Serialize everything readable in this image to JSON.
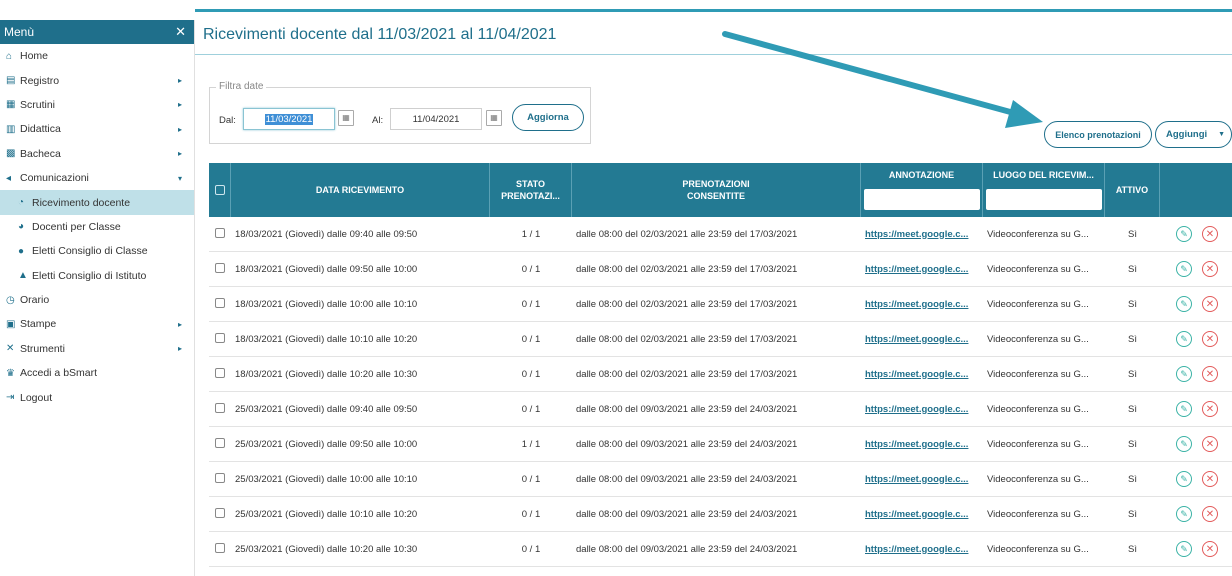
{
  "sidebar": {
    "title": "Menù",
    "close_glyph": "✕",
    "items": [
      {
        "label": "Home",
        "icon": "home-icon",
        "glyph": "⌂",
        "arrow": false,
        "sub": false,
        "active": false
      },
      {
        "label": "Registro",
        "icon": "register-icon",
        "glyph": "▤",
        "arrow": true,
        "sub": false,
        "active": false
      },
      {
        "label": "Scrutini",
        "icon": "scrutini-icon",
        "glyph": "▦",
        "arrow": true,
        "sub": false,
        "active": false
      },
      {
        "label": "Didattica",
        "icon": "book-icon",
        "glyph": "▥",
        "arrow": true,
        "sub": false,
        "active": false
      },
      {
        "label": "Bacheca",
        "icon": "board-icon",
        "glyph": "▩",
        "arrow": true,
        "sub": false,
        "active": false
      },
      {
        "label": "Comunicazioni",
        "icon": "megaphone-icon",
        "glyph": "◂",
        "arrow": true,
        "arrow_down": true,
        "sub": false,
        "active": false
      },
      {
        "label": "Ricevimento docente",
        "icon": "chat-icon",
        "glyph": "◔",
        "arrow": false,
        "sub": true,
        "active": true
      },
      {
        "label": "Docenti per Classe",
        "icon": "comment-icon",
        "glyph": "◕",
        "arrow": false,
        "sub": true,
        "active": false
      },
      {
        "label": "Eletti Consiglio di Classe",
        "icon": "group-icon",
        "glyph": "●",
        "arrow": false,
        "sub": true,
        "active": false
      },
      {
        "label": "Eletti Consiglio di Istituto",
        "icon": "building-icon",
        "glyph": "▲",
        "arrow": false,
        "sub": true,
        "active": false
      },
      {
        "label": "Orario",
        "icon": "clock-icon",
        "glyph": "◷",
        "arrow": false,
        "sub": false,
        "active": false
      },
      {
        "label": "Stampe",
        "icon": "print-icon",
        "glyph": "▣",
        "arrow": true,
        "sub": false,
        "active": false
      },
      {
        "label": "Strumenti",
        "icon": "tools-icon",
        "glyph": "✕",
        "arrow": true,
        "sub": false,
        "active": false
      },
      {
        "label": "Accedi a bSmart",
        "icon": "bsmart-icon",
        "glyph": "♛",
        "arrow": false,
        "sub": false,
        "active": false
      },
      {
        "label": "Logout",
        "icon": "logout-icon",
        "glyph": "⇥",
        "arrow": false,
        "sub": false,
        "active": false
      }
    ]
  },
  "page": {
    "title": "Ricevimenti docente dal 11/03/2021 al 11/04/2021"
  },
  "filter": {
    "legend": "Filtra date",
    "from_label": "Dal:",
    "from_value": "11/03/2021",
    "to_label": "Al:",
    "to_value": "11/04/2021",
    "refresh_label": "Aggiorna"
  },
  "toolbar": {
    "bookings_label": "Elenco prenotazioni",
    "add_label": "Aggiungi",
    "add_caret": "▼"
  },
  "table": {
    "headers": {
      "date": "DATA RICEVIMENTO",
      "state_line1": "STATO",
      "state_line2": "PRENOTAZI...",
      "allowed_line1": "PRENOTAZIONI",
      "allowed_line2": "CONSENTITE",
      "annotation": "ANNOTAZIONE",
      "place": "LUOGO DEL RICEVIM...",
      "active": "ATTIVO"
    },
    "rows": [
      {
        "date": "18/03/2021 (Giovedì) dalle 09:40 alle 09:50",
        "state": "1 / 1",
        "allowed": "dalle 08:00 del 02/03/2021 alle 23:59 del 17/03/2021",
        "annotation": "https://meet.google.c...",
        "place": "Videoconferenza su G...",
        "active": "Sì"
      },
      {
        "date": "18/03/2021 (Giovedì) dalle 09:50 alle 10:00",
        "state": "0 / 1",
        "allowed": "dalle 08:00 del 02/03/2021 alle 23:59 del 17/03/2021",
        "annotation": "https://meet.google.c...",
        "place": "Videoconferenza su G...",
        "active": "Sì"
      },
      {
        "date": "18/03/2021 (Giovedì) dalle 10:00 alle 10:10",
        "state": "0 / 1",
        "allowed": "dalle 08:00 del 02/03/2021 alle 23:59 del 17/03/2021",
        "annotation": "https://meet.google.c...",
        "place": "Videoconferenza su G...",
        "active": "Sì"
      },
      {
        "date": "18/03/2021 (Giovedì) dalle 10:10 alle 10:20",
        "state": "0 / 1",
        "allowed": "dalle 08:00 del 02/03/2021 alle 23:59 del 17/03/2021",
        "annotation": "https://meet.google.c...",
        "place": "Videoconferenza su G...",
        "active": "Sì"
      },
      {
        "date": "18/03/2021 (Giovedì) dalle 10:20 alle 10:30",
        "state": "0 / 1",
        "allowed": "dalle 08:00 del 02/03/2021 alle 23:59 del 17/03/2021",
        "annotation": "https://meet.google.c...",
        "place": "Videoconferenza su G...",
        "active": "Sì"
      },
      {
        "date": "25/03/2021 (Giovedì) dalle 09:40 alle 09:50",
        "state": "0 / 1",
        "allowed": "dalle 08:00 del 09/03/2021 alle 23:59 del 24/03/2021",
        "annotation": "https://meet.google.c...",
        "place": "Videoconferenza su G...",
        "active": "Sì"
      },
      {
        "date": "25/03/2021 (Giovedì) dalle 09:50 alle 10:00",
        "state": "1 / 1",
        "allowed": "dalle 08:00 del 09/03/2021 alle 23:59 del 24/03/2021",
        "annotation": "https://meet.google.c...",
        "place": "Videoconferenza su G...",
        "active": "Sì"
      },
      {
        "date": "25/03/2021 (Giovedì) dalle 10:00 alle 10:10",
        "state": "0 / 1",
        "allowed": "dalle 08:00 del 09/03/2021 alle 23:59 del 24/03/2021",
        "annotation": "https://meet.google.c...",
        "place": "Videoconferenza su G...",
        "active": "Sì"
      },
      {
        "date": "25/03/2021 (Giovedì) dalle 10:10 alle 10:20",
        "state": "0 / 1",
        "allowed": "dalle 08:00 del 09/03/2021 alle 23:59 del 24/03/2021",
        "annotation": "https://meet.google.c...",
        "place": "Videoconferenza su G...",
        "active": "Sì"
      },
      {
        "date": "25/03/2021 (Giovedì) dalle 10:20 alle 10:30",
        "state": "0 / 1",
        "allowed": "dalle 08:00 del 09/03/2021 alle 23:59 del 24/03/2021",
        "annotation": "https://meet.google.c...",
        "place": "Videoconferenza su G...",
        "active": "Sì"
      }
    ]
  },
  "icons": {
    "edit": "✎",
    "delete": "✕",
    "calendar": "▦",
    "arrow_right": "▸",
    "arrow_down": "▾"
  },
  "colors": {
    "primary": "#1f6f8b",
    "header_bg": "#237a93",
    "active_item": "#bfe0e8",
    "edit": "#3bb3a6",
    "delete": "#e35b5b",
    "annotation_arrow": "#2f9bb5"
  }
}
